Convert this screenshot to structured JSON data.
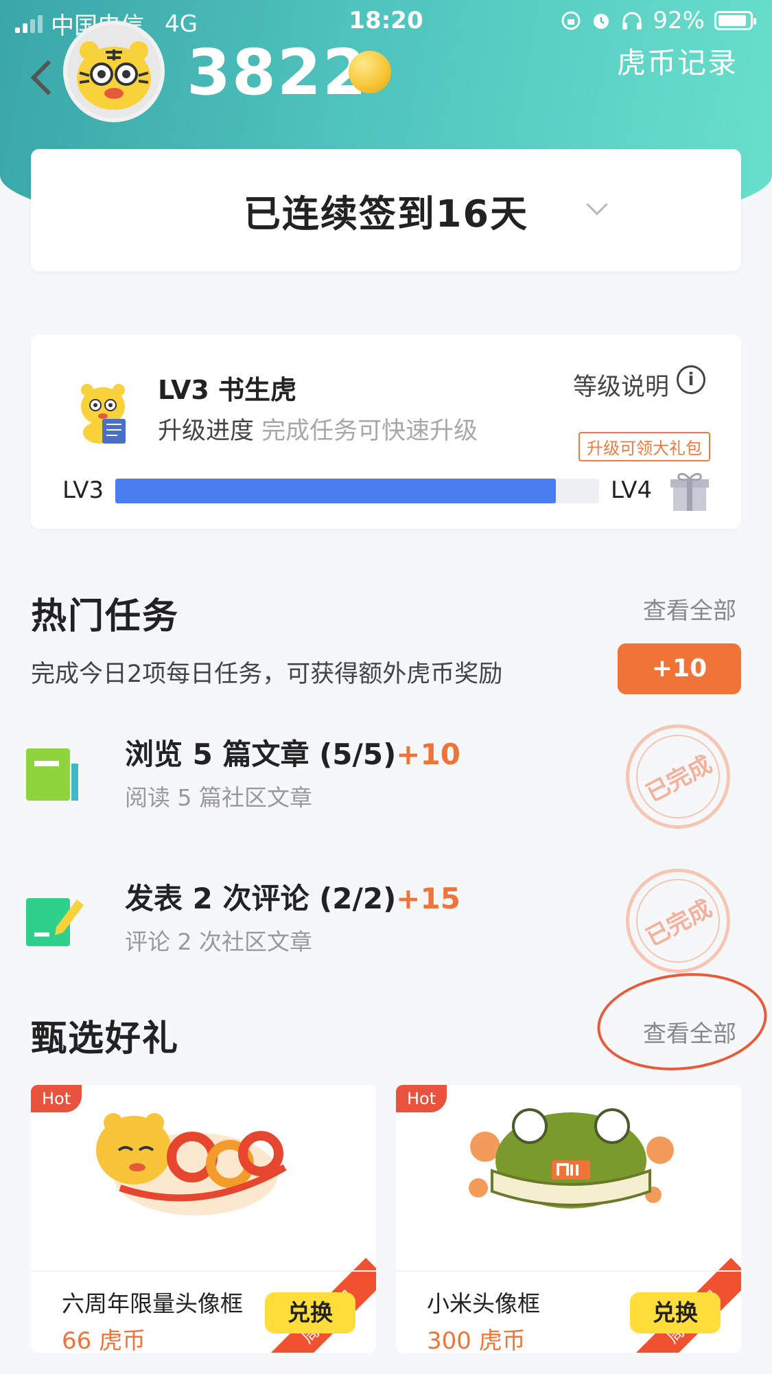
{
  "status_bar": {
    "carrier": "中国电信",
    "network": "4G",
    "time": "18:20",
    "battery": "92%",
    "battery_level": 0.92
  },
  "header": {
    "coins": "3822",
    "record_link": "虎币记录"
  },
  "signin": {
    "text": "已连续签到16天"
  },
  "level": {
    "name": "LV3 书生虎",
    "progress_label": "升级进度",
    "progress_hint": "完成任务可快速升级",
    "explain_link": "等级说明",
    "info_glyph": "i",
    "current": "LV3",
    "next": "LV4",
    "gift_tip": "升级可领大礼包",
    "progress": 0.91
  },
  "hot_tasks": {
    "title": "热门任务",
    "see_all": "查看全部",
    "bonus_text": "完成今日2项每日任务，可获得额外虎币奖励",
    "bonus_button": "+10",
    "tasks": [
      {
        "title": "浏览 5 篇文章 (5/5)",
        "reward": "+10",
        "subtitle": "阅读 5 篇社区文章",
        "status": "已完成",
        "icon": "book-icon"
      },
      {
        "title": "发表 2 次评论 (2/2)",
        "reward": "+15",
        "subtitle": "评论 2 次社区文章",
        "status": "已完成",
        "icon": "edit-note-icon"
      }
    ]
  },
  "gifts": {
    "title": "甄选好礼",
    "see_all": "查看全部",
    "items": [
      {
        "badge": "Hot",
        "ribbon": "周年大促",
        "name": "六周年限量头像框",
        "price": "66 虎币",
        "button": "兑换"
      },
      {
        "badge": "Hot",
        "ribbon": "周年大促",
        "name": "小米头像框",
        "price": "300 虎币",
        "button": "兑换"
      }
    ]
  },
  "colors": {
    "header_gradient_start": "#3aa6a8",
    "header_gradient_end": "#68e0cc",
    "accent_orange": "#f07338",
    "progress_blue": "#4a7ef0",
    "exchange_yellow": "#ffde3b",
    "annotation_red": "#e85a3a"
  }
}
